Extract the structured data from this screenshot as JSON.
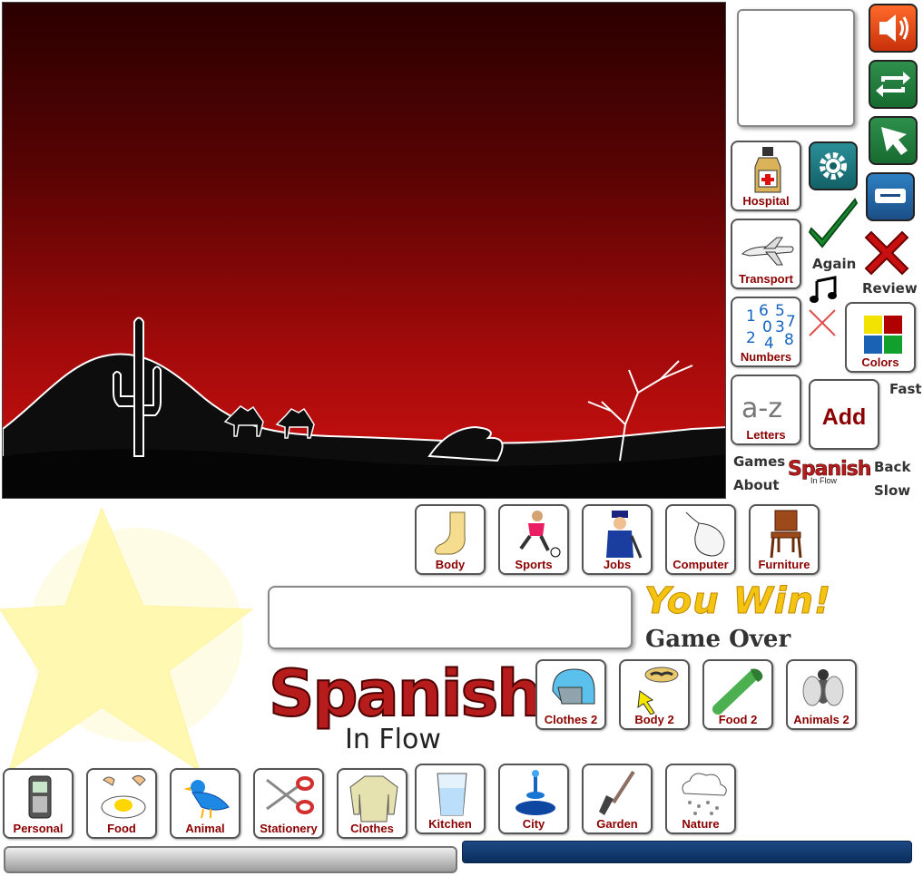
{
  "scene": {
    "name": "desert sunset with cactus and camels"
  },
  "tiles": {
    "hospital": "Hospital",
    "transport": "Transport",
    "numbers": "Numbers",
    "colors": "Colors",
    "letters": "Letters",
    "add": "Add",
    "body": "Body",
    "sports": "Sports",
    "jobs": "Jobs",
    "computer": "Computer",
    "furniture": "Furniture",
    "clothes2": "Clothes 2",
    "body2": "Body 2",
    "food2": "Food 2",
    "animals2": "Animals 2",
    "personal": "Personal",
    "food": "Food",
    "animal": "Animal",
    "stationery": "Stationery",
    "clothes": "Clothes",
    "kitchen": "Kitchen",
    "city": "City",
    "garden": "Garden",
    "nature": "Nature"
  },
  "numbers_glyphs": [
    "1",
    "6",
    "5",
    "0",
    "3",
    "7",
    "2",
    "4",
    "8"
  ],
  "letters_glyph": "a-z",
  "controls": {
    "again": "Again",
    "review": "Review",
    "fast": "Fast",
    "games": "Games",
    "about": "About",
    "back": "Back",
    "slow": "Slow"
  },
  "icons": [
    "speaker-icon",
    "repeat-icon",
    "arrow-icon",
    "keyboard-icon",
    "gear-icon",
    "checkmark-icon",
    "cross-icon",
    "music-note-icon",
    "thin-cross-icon"
  ],
  "status": {
    "you_win": "You Win!",
    "game_over": "Game Over"
  },
  "logo": {
    "main": "Spanish",
    "sub": "In Flow"
  },
  "progress": {
    "value": 0
  },
  "colors": {
    "sky_top": "#2a0000",
    "sky_bottom": "#cf1111",
    "label": "#8b0000",
    "win": "#f4c411",
    "bar": "#0a2d5d"
  }
}
